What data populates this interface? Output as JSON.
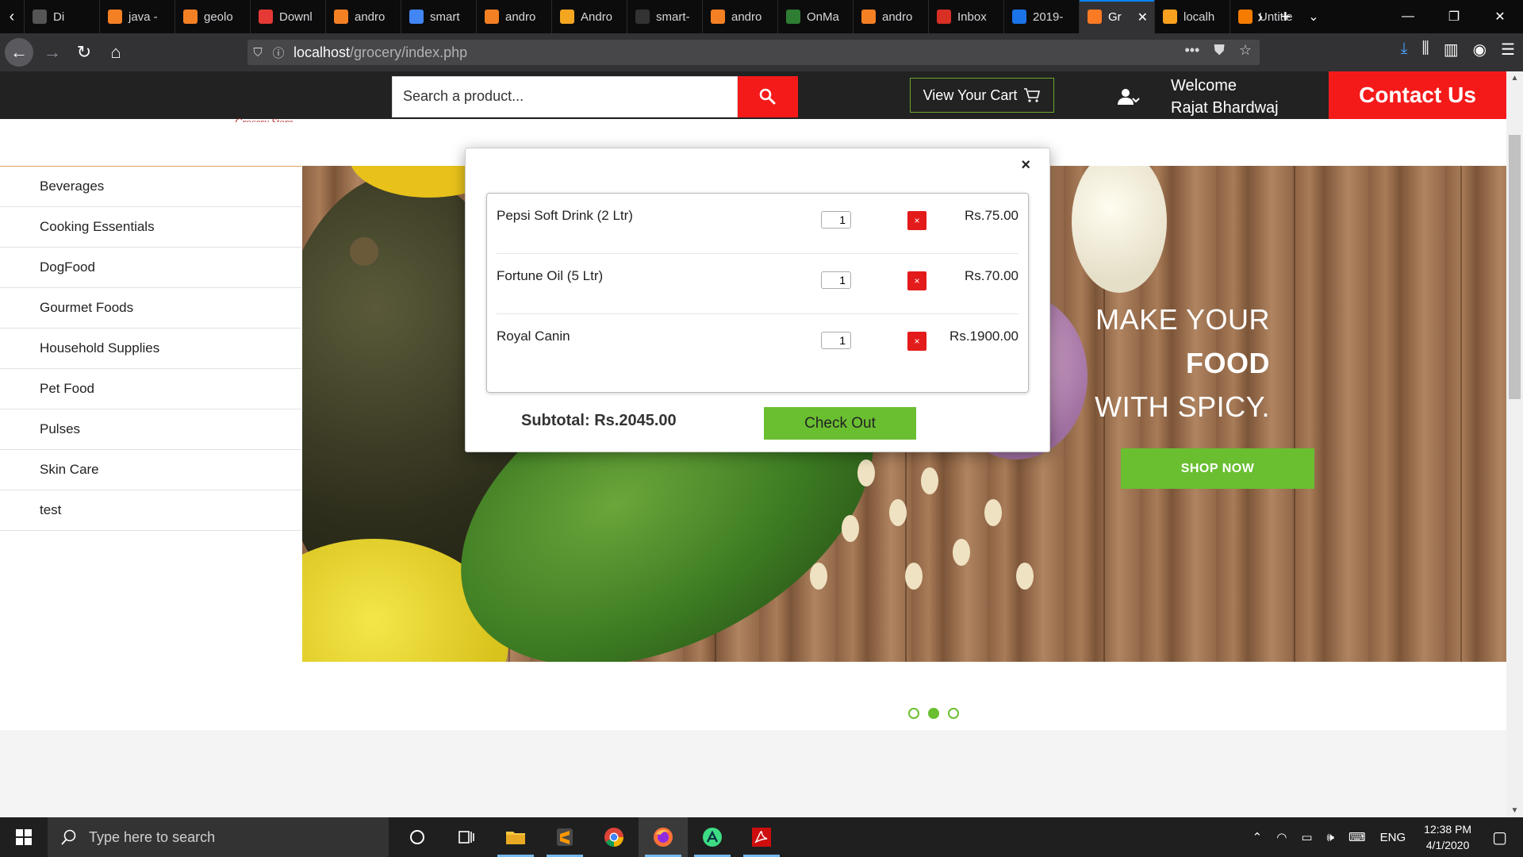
{
  "browser": {
    "tabs": [
      {
        "title": "Di",
        "icon": "document-icon",
        "color": "#555"
      },
      {
        "title": "java -",
        "icon": "stackoverflow-icon",
        "color": "#f48024"
      },
      {
        "title": "geolo",
        "icon": "stackoverflow-icon",
        "color": "#f48024"
      },
      {
        "title": "Downl",
        "icon": "g-icon",
        "color": "#e53935"
      },
      {
        "title": "andro",
        "icon": "stackoverflow-icon",
        "color": "#f48024"
      },
      {
        "title": "smart",
        "icon": "google-icon",
        "color": "#4285f4"
      },
      {
        "title": "andro",
        "icon": "stackoverflow-icon",
        "color": "#f48024"
      },
      {
        "title": "Andro",
        "icon": "j-icon",
        "color": "#f4a620"
      },
      {
        "title": "smart-",
        "icon": "github-icon",
        "color": "#333"
      },
      {
        "title": "andro",
        "icon": "stackoverflow-icon",
        "color": "#f48024"
      },
      {
        "title": "OnMa",
        "icon": "onmap-icon",
        "color": "#2e7d32"
      },
      {
        "title": "andro",
        "icon": "stackoverflow-icon",
        "color": "#f48024"
      },
      {
        "title": "Inbox",
        "icon": "gmail-icon",
        "color": "#d93025"
      },
      {
        "title": "2019-",
        "icon": "contacts-icon",
        "color": "#1a73e8"
      },
      {
        "title": "Gr",
        "icon": "xampp-icon",
        "color": "#fb7a24",
        "active": true
      },
      {
        "title": "localh",
        "icon": "phpmyadmin-icon",
        "color": "#f8a11e"
      },
      {
        "title": "Untitle",
        "icon": "puzzle-icon",
        "color": "#f57c00"
      }
    ],
    "url_host": "localhost",
    "url_path": "/grocery/index.php"
  },
  "header": {
    "search_placeholder": "Search a product...",
    "cart_label": "View Your Cart",
    "welcome_line1": "Welcome",
    "welcome_line2": "Rajat Bhardwaj",
    "contact_label": "Contact Us",
    "logo_text": "Grocery Store"
  },
  "sidebar": {
    "categories": [
      "Beverages",
      "Cooking Essentials",
      "DogFood",
      "Gourmet Foods",
      "Household Supplies",
      "Pet Food",
      "Pulses",
      "Skin Care",
      "test"
    ]
  },
  "hero": {
    "line1": "MAKE YOUR",
    "line2": "FOOD",
    "line3": "WITH SPICY.",
    "cta": "SHOP NOW",
    "slides": 3,
    "active_slide": 2
  },
  "cart": {
    "close": "×",
    "items": [
      {
        "name": "Pepsi Soft Drink (2 Ltr)",
        "qty": "1",
        "remove": "×",
        "price": "Rs.75.00"
      },
      {
        "name": "Fortune Oil (5 Ltr)",
        "qty": "1",
        "remove": "×",
        "price": "Rs.70.00"
      },
      {
        "name": "Royal Canin",
        "qty": "1",
        "remove": "×",
        "price": "Rs.1900.00"
      }
    ],
    "subtotal": "Subtotal: Rs.2045.00",
    "checkout": "Check Out"
  },
  "taskbar": {
    "search_placeholder": "Type here to search",
    "lang": "ENG",
    "time": "12:38 PM",
    "date": "4/1/2020"
  },
  "colors": {
    "accent_red": "#f51a1a",
    "accent_green": "#6abf31",
    "header_bg": "#222222"
  }
}
